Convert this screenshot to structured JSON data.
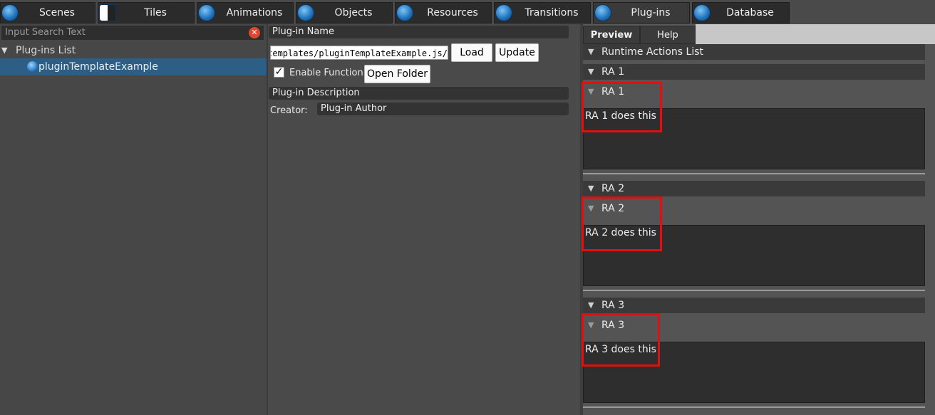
{
  "tabs": [
    {
      "label": "Scenes",
      "icon": "scenes-icon"
    },
    {
      "label": "Tiles",
      "icon": "tiles-icon"
    },
    {
      "label": "Animations",
      "icon": "animations-icon"
    },
    {
      "label": "Objects",
      "icon": "objects-icon"
    },
    {
      "label": "Resources",
      "icon": "resources-icon"
    },
    {
      "label": "Transitions",
      "icon": "transitions-icon"
    },
    {
      "label": "Plug-ins",
      "icon": "plugins-icon"
    },
    {
      "label": "Database",
      "icon": "database-icon"
    }
  ],
  "active_tab": "Plug-ins",
  "left": {
    "search_placeholder": "Input Search Text",
    "tree_root": "Plug-ins List",
    "tree_item": "pluginTemplateExample"
  },
  "middle": {
    "plugin_name_header": "Plug-in Name",
    "path_value": "/templates/pluginTemplateExample.js",
    "load_label": "Load",
    "update_label": "Update",
    "enable_label": "Enable Function",
    "enable_checked": true,
    "open_folder_label": "Open Folder",
    "description_header": "Plug-in Description",
    "creator_label": "Creator:",
    "creator_value": "Plug-in Author"
  },
  "right": {
    "tabs": [
      "Preview",
      "Help"
    ],
    "list_header": "Runtime Actions List",
    "actions": [
      {
        "section": "RA 1",
        "name": "RA 1",
        "description": "RA 1 does this"
      },
      {
        "section": "RA 2",
        "name": "RA 2",
        "description": "RA 2 does this"
      },
      {
        "section": "RA 3",
        "name": "RA 3",
        "description": "RA 3 does this"
      }
    ],
    "highlight_color": "#e01010"
  },
  "colors": {
    "selection": "#2c5e86",
    "panel_bg": "#474747"
  }
}
